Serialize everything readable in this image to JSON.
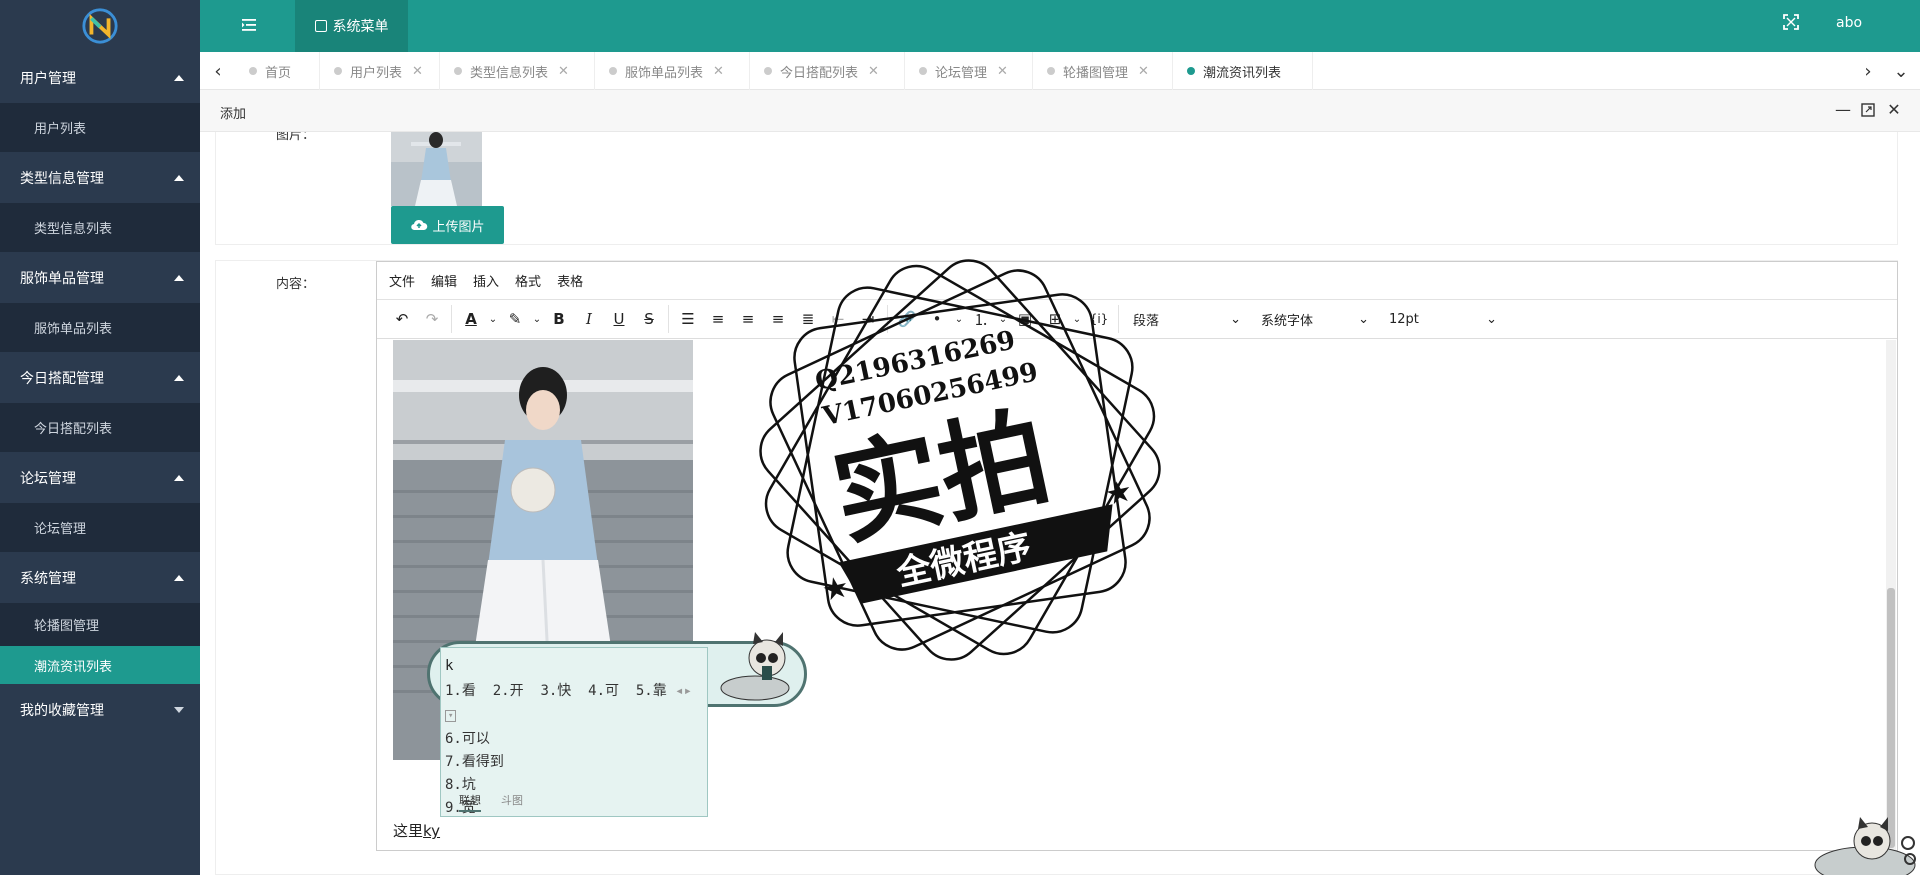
{
  "sidebar": {
    "groups": [
      {
        "label": "用户管理",
        "items": [
          "用户列表"
        ]
      },
      {
        "label": "类型信息管理",
        "items": [
          "类型信息列表"
        ]
      },
      {
        "label": "服饰单品管理",
        "items": [
          "服饰单品列表"
        ]
      },
      {
        "label": "今日搭配管理",
        "items": [
          "今日搭配列表"
        ]
      },
      {
        "label": "论坛管理",
        "items": [
          "论坛管理"
        ]
      },
      {
        "label": "系统管理",
        "items": [
          "轮播图管理",
          "潮流资讯列表"
        ]
      },
      {
        "label": "我的收藏管理",
        "items": []
      }
    ],
    "active_item": "潮流资讯列表"
  },
  "topbar": {
    "system_menu_label": "系统菜单",
    "username": "abo",
    "accent_color": "#1e9a8f"
  },
  "tabs": [
    {
      "label": "首页",
      "closable": false
    },
    {
      "label": "用户列表",
      "closable": true
    },
    {
      "label": "类型信息列表",
      "closable": true
    },
    {
      "label": "服饰单品列表",
      "closable": true
    },
    {
      "label": "今日搭配列表",
      "closable": true
    },
    {
      "label": "论坛管理",
      "closable": true
    },
    {
      "label": "轮播图管理",
      "closable": true
    },
    {
      "label": "潮流资讯列表",
      "closable": false,
      "active": true
    }
  ],
  "dialog": {
    "title": "添加",
    "image_label": "图片：",
    "upload_label": "上传图片",
    "content_label": "内容："
  },
  "editor": {
    "menus": [
      "文件",
      "编辑",
      "插入",
      "格式",
      "表格"
    ],
    "block_format": "段落",
    "font_family": "系统字体",
    "font_size": "12pt",
    "typed_prefix": "这里",
    "typed_pending": "ky"
  },
  "ime": {
    "input": "k",
    "candidates_row": [
      "1.看",
      "2.开",
      "3.快",
      "4.可",
      "5.靠"
    ],
    "candidates_list": [
      "6.可以",
      "7.看得到",
      "8.坑",
      "9.宽"
    ],
    "tab_active": "联想",
    "tab_other": "斗图"
  },
  "watermark": {
    "line1": "Q2196316269",
    "line2": "V17060256499",
    "big": "实拍",
    "banner": "全微程序"
  }
}
